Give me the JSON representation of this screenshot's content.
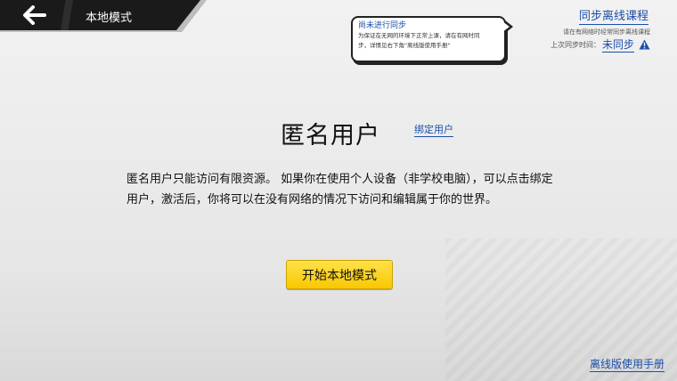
{
  "header": {
    "mode_title": "本地模式",
    "back_icon": "arrow-left-icon"
  },
  "notice": {
    "title": "尚未进行同步",
    "body_line1": "为保证在无网的环境下正常上课，请在有网时同",
    "body_line2": "步，详情见右下角\"离线版使用手册\""
  },
  "sync": {
    "link_label": "同步离线课程",
    "hint": "请在有网络时经常同步离线课程",
    "last_sync_label": "上次同步时间：",
    "last_sync_value": "未同步",
    "warning_icon": "warning-icon"
  },
  "main": {
    "user_title": "匿名用户",
    "bind_label": "绑定用户",
    "description": "匿名用户只能访问有限资源。 如果你在使用个人设备（非学校电脑），可以点击绑定用户，激活后，你将可以在没有网络的情况下访问和编辑属于你的世界。",
    "start_button": "开始本地模式"
  },
  "footer": {
    "manual_link": "离线版使用手册"
  },
  "colors": {
    "link": "#1a4fa8",
    "button": "#f8c800",
    "banner": "#1a1a1a"
  }
}
